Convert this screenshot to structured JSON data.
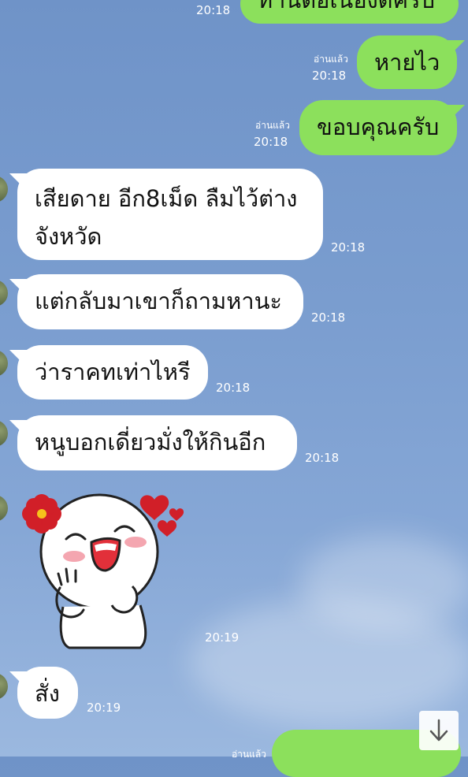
{
  "messages": {
    "m0": {
      "text": "ทานต่อเนื่องดีครับ",
      "time": "20:18"
    },
    "m1": {
      "text": "หายไว",
      "time": "20:18",
      "read": "อ่านแล้ว"
    },
    "m2": {
      "text": "ขอบคุณครับ",
      "time": "20:18",
      "read": "อ่านแล้ว"
    },
    "m3": {
      "line1": "เสียดาย อีก8เม็ด ลืมไว้ต่าง",
      "line2": "จังหวัด",
      "time": "20:18"
    },
    "m4": {
      "text": "แต่กลับมาเขาก็ถามหานะ",
      "time": "20:18"
    },
    "m5": {
      "text": "ว่าราคทเท่าไหรี",
      "time": "20:18"
    },
    "m6": {
      "text": "หนูบอกเดี่ยวมั่งให้กินอีก",
      "time": "20:18"
    },
    "m7": {
      "sticker": "cheerful-girl-sticker",
      "time": "20:19"
    },
    "m8": {
      "text": "สั่ง",
      "time": "20:19"
    },
    "m9": {
      "read": "อ่านแล้ว"
    }
  },
  "icons": {
    "scroll_down": "arrow-down-icon"
  },
  "colors": {
    "outgoing": "#8ce05c",
    "incoming": "#ffffff",
    "background": "#7a9dcf"
  }
}
